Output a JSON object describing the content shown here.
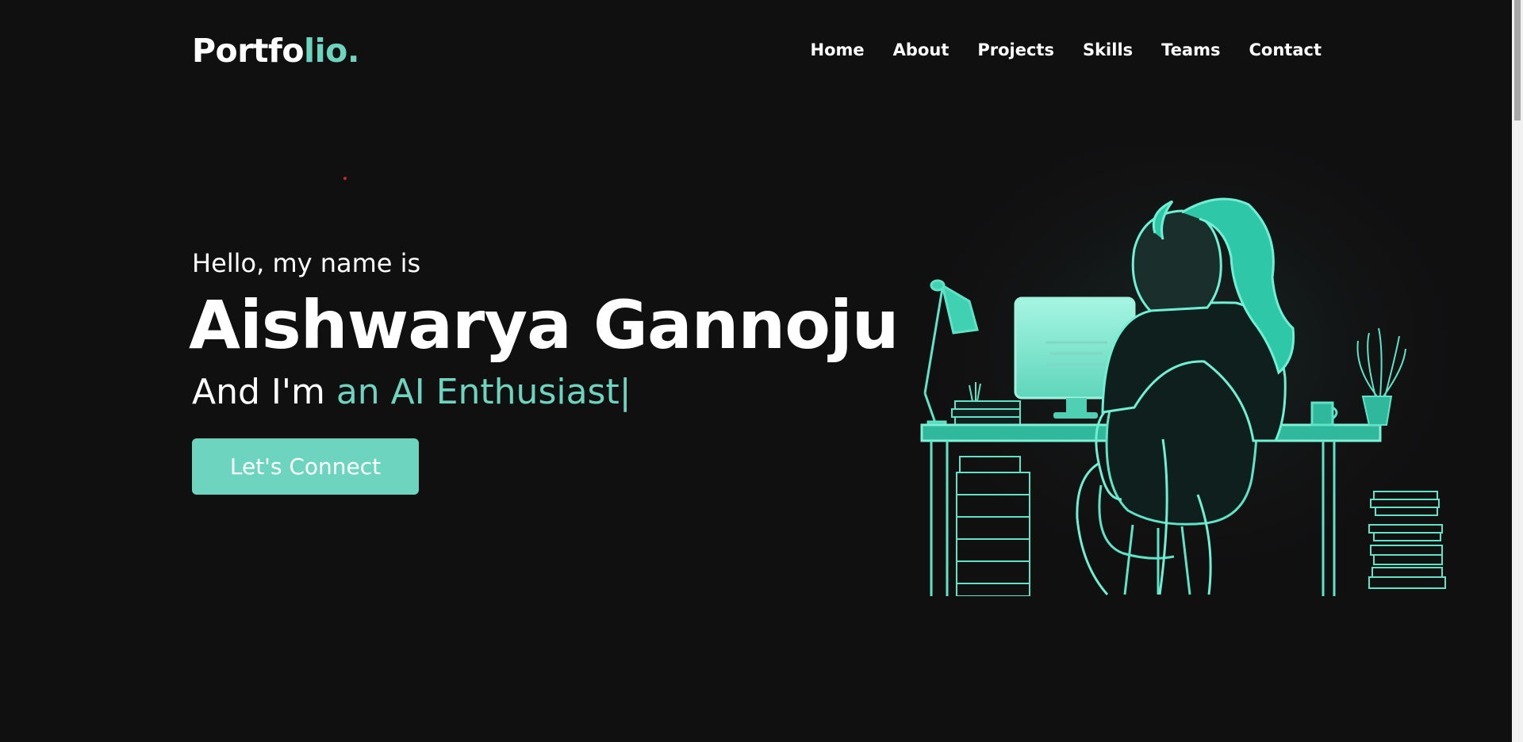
{
  "header": {
    "logo_main": "Portfo",
    "logo_accent": "lio.",
    "nav": [
      {
        "label": "Home"
      },
      {
        "label": "About"
      },
      {
        "label": "Projects"
      },
      {
        "label": "Skills"
      },
      {
        "label": "Teams"
      },
      {
        "label": "Contact"
      }
    ]
  },
  "hero": {
    "greeting": "Hello, my name is",
    "name": "Aishwarya Gannoju",
    "role_prefix": "And I'm ",
    "role_value": "an AI Enthusiast",
    "cursor": "|",
    "cta_label": "Let's Connect"
  },
  "colors": {
    "background": "#111011",
    "accent": "#6dd5bf",
    "text": "#ffffff"
  }
}
